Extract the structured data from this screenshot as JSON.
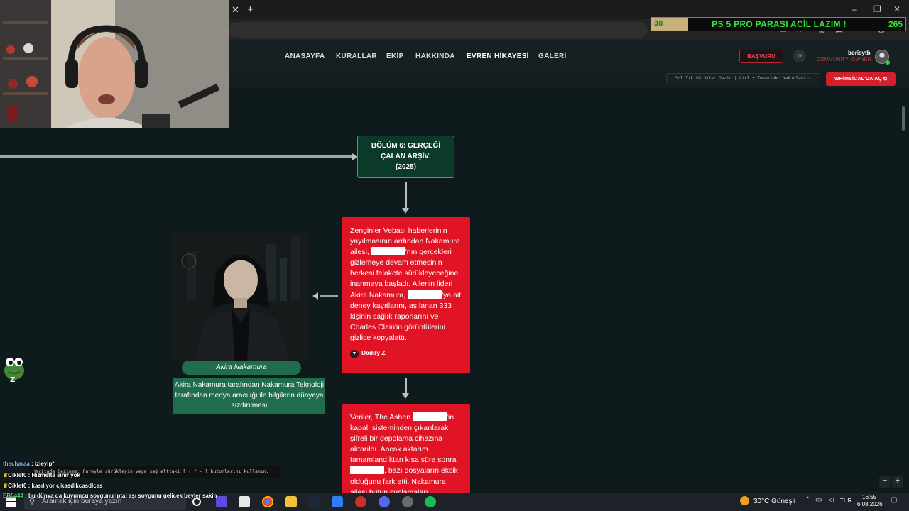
{
  "browser": {
    "close_glyph": "✕",
    "newtab_glyph": "+",
    "min_glyph": "–",
    "max_glyph": "❐",
    "winclose_glyph": "✕"
  },
  "donation": {
    "current": "38",
    "title": "PS 5 PRO PARASI ACİL LAZIM !",
    "goal": "265"
  },
  "nav": {
    "links": [
      "ANASAYFA",
      "KURALLAR",
      "EKİP",
      "HAKKINDA",
      "EVREN HİKAYESİ",
      "GALERİ"
    ],
    "apply": "BAŞVURU",
    "theme_glyph": "☼",
    "user_name": "borisytb",
    "user_role": "COMMUNITY_OWNER"
  },
  "toolbar": {
    "hint": "Sol Tık Sürükle: Gezin | Ctrl + Tekerlek: Yakınlaştır",
    "open_button": "WHİMSİCAL'DA AÇ ⧉"
  },
  "flow": {
    "chapter_lines": [
      "BÖLÜM 6: GERÇEĞİ",
      "ÇALAN ARŞİV:",
      "(2025)"
    ],
    "card1": {
      "p1": "Zenginler Vebası haberlerinin yayılmasının ardından Nakamura ailesi, ",
      "p2": "'nın gerçekleri gizlemeye devam etmesinin herkesi felakete sürükleyeceğine inanmaya başladı. Ailenin lideri Akira Nakamura, ",
      "p3": "'ya ait deney kayıtlarını, aşılanan 333 kişinin sağlık raporlarını ve Charles Clain'in görüntülerini gizlice kopyalattı.",
      "author": "Daddy Z"
    },
    "card2": {
      "p1": "Veriler, The Ashen ",
      "p2": "'in kapalı sisteminden çıkarılarak şifreli bir depolama cihazına aktarıldı. Ancak aktarım tamamlandıktan kısa süre sonra ",
      "p3": ", bazı dosyaların eksik olduğunu fark etti. Nakamura ailesi bütün suçlamaları"
    },
    "character_name": "Akira Nakamura",
    "character_caption": "Akira Nakamura tarafından Nakamura Teknoloji tarafından medya aracılığı ile bilgilerin dünyaya sızdırılması"
  },
  "chat": [
    {
      "user": "thecharaa",
      "text": " : izleyip*"
    },
    {
      "user": "Ciklet0",
      "text": " : Hizmette sınır yok"
    },
    {
      "user": "Ciklet0",
      "text": " : kasılıyor cjkasdlkcasdlcas"
    },
    {
      "user": "EB0444",
      "text": " : bu dünya da kuyumcu soygunu iptal aşı soygunu gelicek beyler sakin"
    }
  ],
  "chat_tooltip": "Haritada Gezinme: Fareyle sürükleyin veya sağ alttaki [ + / - ] butonlarını kullanın.",
  "zoom": {
    "minus": "−",
    "plus": "+"
  },
  "taskbar": {
    "search_placeholder": "Aramak için buraya yazın",
    "weather": "30°C  Güneşli",
    "lang": "TUR",
    "time": "16:55",
    "date": "6.08.2026"
  }
}
